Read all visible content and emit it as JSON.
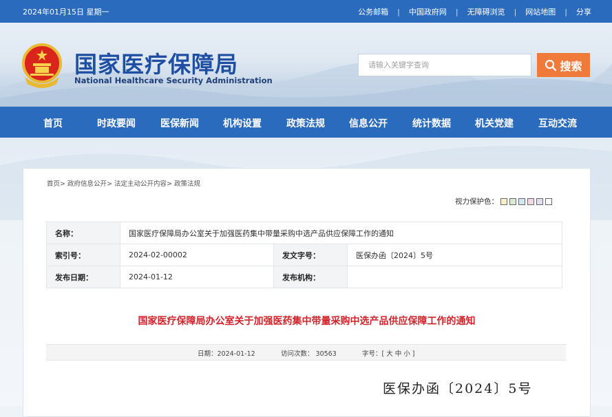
{
  "topbar": {
    "date": "2024年01月15日 星期一",
    "links": [
      "公务邮箱",
      "中国政府网",
      "无障碍浏览",
      "网站地图",
      "分享"
    ]
  },
  "header": {
    "title": "国家医疗保障局",
    "subtitle": "National Healthcare Security Administration",
    "search_placeholder": "请输入关键字查询",
    "search_label": "搜索"
  },
  "nav": [
    "首页",
    "时政要闻",
    "医保新闻",
    "机构设置",
    "政策法规",
    "信息公开",
    "统计数据",
    "机关党建",
    "互动交流"
  ],
  "breadcrumb": [
    "首页",
    "政府信息公开",
    "法定主动公开内容",
    "政策法规"
  ],
  "eye_protect": {
    "label": "视力保护色：",
    "colors": [
      "#f7f1c9",
      "#d9ebd0",
      "#d3e6f3",
      "#f3d8e6",
      "#e0e0f0",
      "#ffffff"
    ]
  },
  "meta": {
    "name_label": "名称：",
    "name_value": "国家医疗保障局办公室关于加强医药集中带量采购中选产品供应保障工作的通知",
    "index_label": "索引号：",
    "index_value": "2024-02-00002",
    "docno_label": "发文字号：",
    "docno_value": "医保办函〔2024〕5号",
    "date_label": "发布日期：",
    "date_value": "2024-01-12",
    "org_label": "发布机构：",
    "org_value": ""
  },
  "article": {
    "title": "国家医疗保障局办公室关于加强医药集中带量采购中选产品供应保障工作的通知",
    "date": "日期：2024-01-12",
    "visits": "访问次数： 30563",
    "fontsize": "字号：[ 大 中 小 ]",
    "doc_number": "医保办函〔2024〕5号"
  },
  "colors": {
    "primary": "#2a6bbd",
    "accent": "#f07a3a",
    "title_red": "#d2232a"
  }
}
